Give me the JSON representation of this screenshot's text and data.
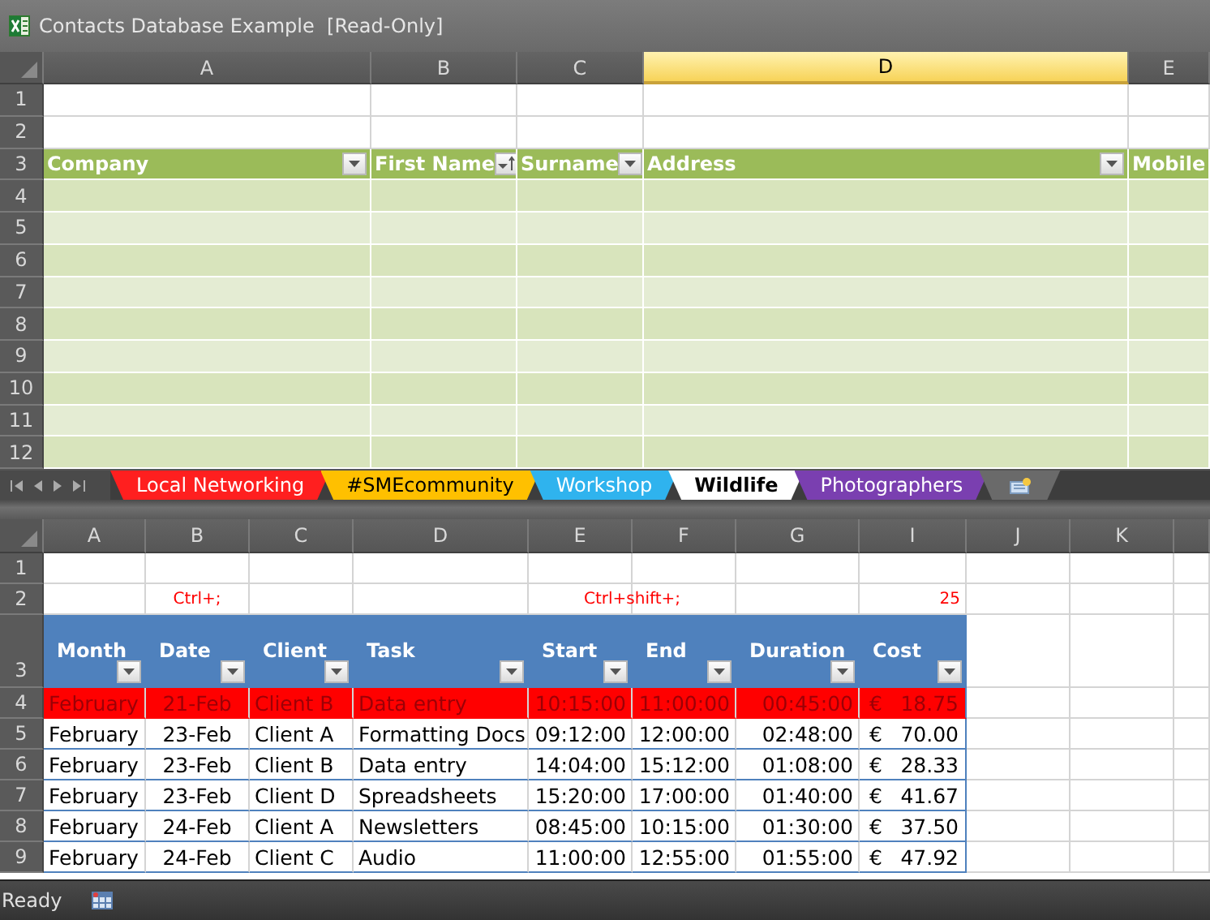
{
  "window": {
    "title": "Contacts Database Example  [Read-Only]"
  },
  "top_sheet": {
    "columns": [
      {
        "label": "A",
        "selected": false
      },
      {
        "label": "B",
        "selected": false
      },
      {
        "label": "C",
        "selected": false
      },
      {
        "label": "D",
        "selected": true
      },
      {
        "label": "E",
        "selected": false
      }
    ],
    "blank_rows": [
      "1",
      "2"
    ],
    "header_row": "3",
    "headers": [
      {
        "text": "Company",
        "kind": "dropdown"
      },
      {
        "text": "First Name",
        "kind": "sorted"
      },
      {
        "text": "Surname",
        "kind": "dropdown"
      },
      {
        "text": "Address",
        "kind": "dropdown"
      },
      {
        "text": "Mobile",
        "kind": "plain"
      }
    ],
    "body_rows": [
      "4",
      "5",
      "6",
      "7",
      "8",
      "9",
      "10",
      "11",
      "12"
    ]
  },
  "sheet_tabs": [
    {
      "label": "Local Networking",
      "color": "#ff1f1f",
      "selected": false
    },
    {
      "label": "#SMEcommunity",
      "color": "#ffc000",
      "selected": false
    },
    {
      "label": "Workshop",
      "color": "#2fb3ee",
      "selected": false
    },
    {
      "label": "Wildlife",
      "color": "#ffffff",
      "selected": true
    },
    {
      "label": "Photographers",
      "color": "#7a3fb0",
      "selected": false
    }
  ],
  "bottom_sheet": {
    "columns": [
      "A",
      "B",
      "C",
      "D",
      "E",
      "F",
      "G",
      "I",
      "J",
      "K"
    ],
    "row_1": "1",
    "row_2": {
      "number": "2",
      "date_shortcut": "Ctrl+;",
      "time_shortcut": "Ctrl+shift+;",
      "count": "25"
    },
    "header_row": "3",
    "headers": [
      "Month",
      "Date",
      "Client",
      "Task",
      "Start",
      "End",
      "Duration",
      "Cost"
    ],
    "rows": [
      {
        "number": "4",
        "highlighted": true,
        "cells": [
          "February",
          "21-Feb",
          "Client B",
          "Data entry",
          "10:15:00",
          "11:00:00",
          "00:45:00"
        ],
        "currency": "€",
        "amount": "18.75"
      },
      {
        "number": "5",
        "highlighted": false,
        "cells": [
          "February",
          "23-Feb",
          "Client A",
          "Formatting Docs",
          "09:12:00",
          "12:00:00",
          "02:48:00"
        ],
        "currency": "€",
        "amount": "70.00"
      },
      {
        "number": "6",
        "highlighted": false,
        "cells": [
          "February",
          "23-Feb",
          "Client B",
          "Data entry",
          "14:04:00",
          "15:12:00",
          "01:08:00"
        ],
        "currency": "€",
        "amount": "28.33"
      },
      {
        "number": "7",
        "highlighted": false,
        "cells": [
          "February",
          "23-Feb",
          "Client D",
          "Spreadsheets",
          "15:20:00",
          "17:00:00",
          "01:40:00"
        ],
        "currency": "€",
        "amount": "41.67"
      },
      {
        "number": "8",
        "highlighted": false,
        "cells": [
          "February",
          "24-Feb",
          "Client A",
          "Newsletters",
          "08:45:00",
          "10:15:00",
          "01:30:00"
        ],
        "currency": "€",
        "amount": "37.50"
      },
      {
        "number": "9",
        "highlighted": false,
        "cells": [
          "February",
          "24-Feb",
          "Client C",
          "Audio",
          "11:00:00",
          "12:55:00",
          "01:55:00"
        ],
        "currency": "€",
        "amount": "47.92"
      }
    ]
  },
  "status_bar": {
    "text": "Ready"
  }
}
